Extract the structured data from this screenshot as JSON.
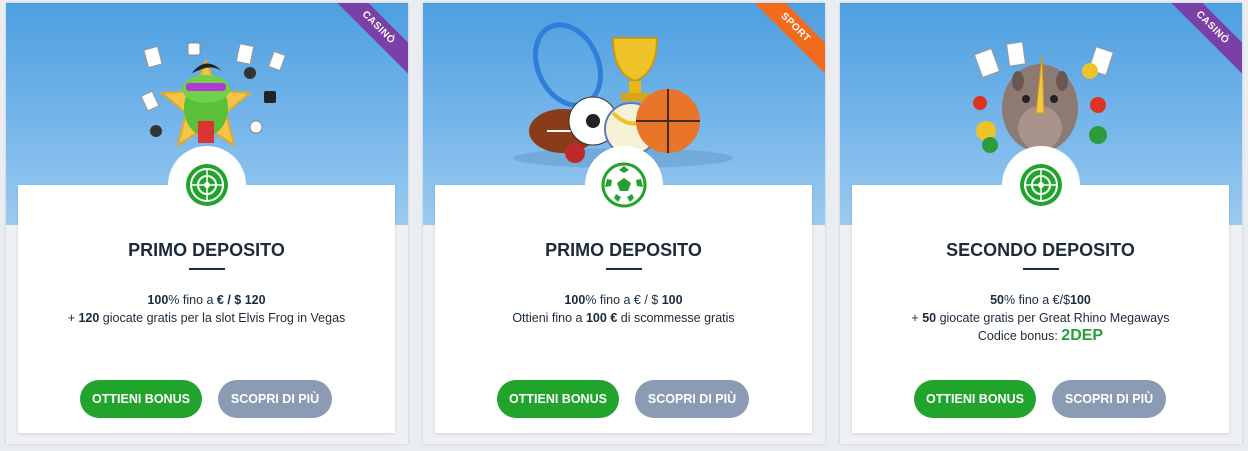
{
  "cards": [
    {
      "ribbon": "CASINÒ",
      "ribbon_color": "#7b3fa8",
      "badge_icon": "roulette-icon",
      "title": "PRIMO DEPOSITO",
      "line1_pct": "100",
      "line1_mid": "% fino a ",
      "line1_amount": "€ / $ 120",
      "line2_prefix": "+ ",
      "line2_num": "120",
      "line2_text": " giocate gratis per la slot Elvis Frog in Vegas",
      "bonus_label": "OTTIENI BONUS",
      "more_label": "SCOPRI DI PIÙ"
    },
    {
      "ribbon": "SPORT",
      "ribbon_color": "#f26a1b",
      "badge_icon": "soccer-ball-icon",
      "title": "PRIMO DEPOSITO",
      "line1_pct": "100",
      "line1_mid": "% fino a € / $ ",
      "line1_amount": "100",
      "line2_prefix": "Ottieni fino a ",
      "line2_num": "100 €",
      "line2_text": " di scommesse gratis",
      "bonus_label": "OTTIENI BONUS",
      "more_label": "SCOPRI DI PIÙ"
    },
    {
      "ribbon": "CASINÒ",
      "ribbon_color": "#7b3fa8",
      "badge_icon": "roulette-icon",
      "title": "SECONDO DEPOSITO",
      "line1_pct": "50",
      "line1_mid": "% fino a €/$",
      "line1_amount": "100",
      "line2_prefix": "+ ",
      "line2_num": "50",
      "line2_text": " giocate gratis per Great Rhino Megaways",
      "code_label": "Codice bonus: ",
      "code_value": "2DEP",
      "bonus_label": "OTTIENI BONUS",
      "more_label": "SCOPRI DI PIÙ"
    }
  ],
  "colors": {
    "accent_green": "#21a32c",
    "secondary_button": "#8a9bb3",
    "title_text": "#1c2b3a"
  }
}
